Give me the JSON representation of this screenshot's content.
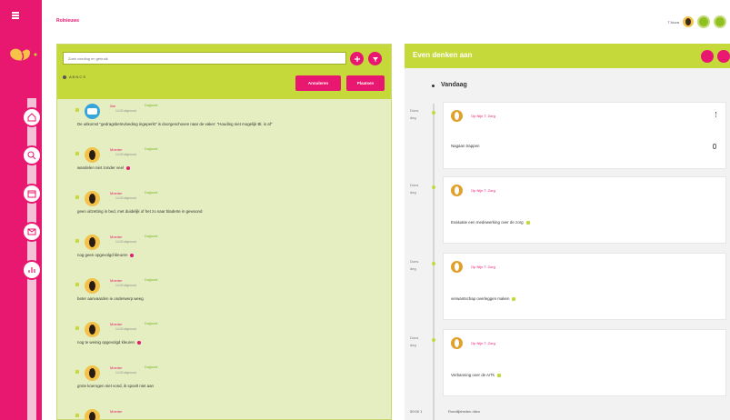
{
  "header": {
    "left_label": "Rolnieuws",
    "user_label": "T.Nova"
  },
  "sidebar": {
    "items": [
      {
        "icon": "home-icon"
      },
      {
        "icon": "search-icon"
      },
      {
        "icon": "calendar-icon"
      },
      {
        "icon": "mail-icon"
      },
      {
        "icon": "chart-icon"
      }
    ]
  },
  "left_panel": {
    "search_placeholder": "Zoek voeding en gebruik",
    "filters": "A  B  N  C  S",
    "buttons": [
      "Annuleren",
      "Plaatsen"
    ],
    "messages": [
      {
        "name": "Ilse",
        "tag": "Dagboek",
        "time": "14.00 afgerond",
        "text": "De uitkomst \"gedragsbeïnvloeding ingeperkt\" is doorgeschoven naar de vaker: \"Houding niet mogelijk Bl. is af\"",
        "avatar": "blue",
        "heart": false
      },
      {
        "name": "Moeder",
        "tag": "Dagboek",
        "time": "14.00 afgerond",
        "text": "wandelen niet zonder veel",
        "avatar": "face",
        "heart": true
      },
      {
        "name": "Moeder",
        "tag": "Dagboek",
        "time": "14.00 afgerond",
        "text": "geen uitzetting in bed, met duidelijk of het zo naar bladerte in gewoond",
        "avatar": "face",
        "heart": false
      },
      {
        "name": "Moeder",
        "tag": "Dagboek",
        "time": "14.00 afgerond",
        "text": "nog geen opgevolgd kleuren",
        "avatar": "face",
        "heart": true
      },
      {
        "name": "Moeder",
        "tag": "Dagboek",
        "time": "14.00 afgerond",
        "text": "beter aanvaarden ie onderwerp weeg",
        "avatar": "face",
        "heart": false
      },
      {
        "name": "Moeder",
        "tag": "Dagboek",
        "time": "14.00 afgerond",
        "text": "nog te weinig opgevolgd kleuren",
        "avatar": "face",
        "heart": true
      },
      {
        "name": "Moeder",
        "tag": "Dagboek",
        "time": "14.00 afgerond",
        "text": "grote koerogen niet vond, ik spoelt niet aan",
        "avatar": "face",
        "heart": false
      },
      {
        "name": "Moeder",
        "tag": "",
        "time": "",
        "text": "",
        "avatar": "face",
        "heart": false
      }
    ]
  },
  "right_panel": {
    "title": "Even denken aan",
    "day_label": "Vandaag",
    "entries": [
      {
        "time_line1": "Dons",
        "time_line2": "deg",
        "name": "Op Nijn T. Zorg",
        "text": "Nagaan trappen",
        "check": false
      },
      {
        "time_line1": "Dons",
        "time_line2": "deg",
        "name": "Op Nijn T. Zorg",
        "text": "Evaluatie een medewerking over de zorg",
        "check": true
      },
      {
        "time_line1": "Dons",
        "time_line2": "deg",
        "name": "Op Nijn T. Zorg",
        "text": "verwantschap overleggen maken",
        "check": true
      },
      {
        "time_line1": "Dons",
        "time_line2": "deg",
        "name": "Op Nijn T. Zorg",
        "text": "Verbanning over de ArTs",
        "check": true
      }
    ],
    "footer_time": "00:00 1",
    "footer_text": "Rondlijkheden ditzo"
  }
}
